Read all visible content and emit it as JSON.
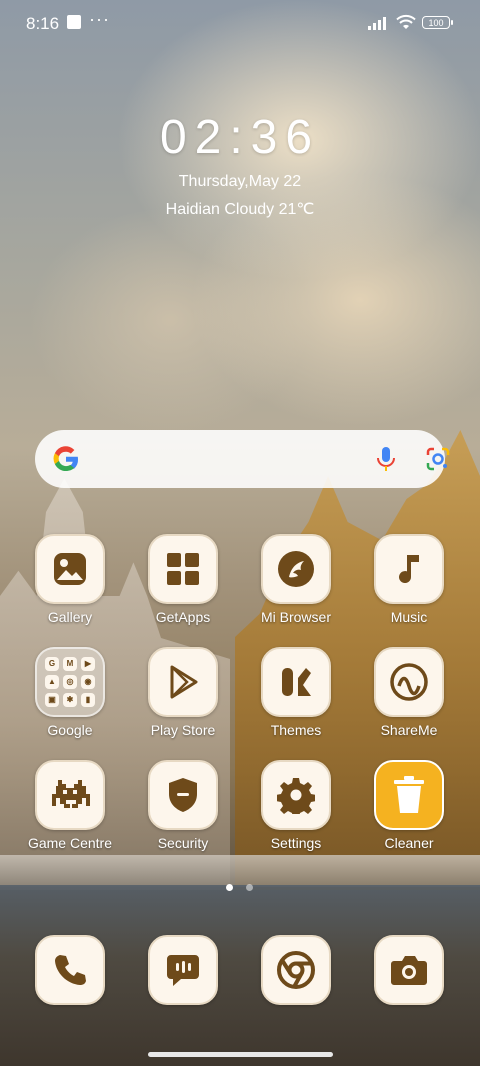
{
  "status_bar": {
    "time": "8:16",
    "more": "···",
    "battery": "100"
  },
  "clock_widget": {
    "time": "02:36",
    "date": "Thursday,May 22",
    "weather": "Haidian Cloudy 21℃"
  },
  "search_bar": {
    "google_icon": "google-g-icon",
    "mic_icon": "mic-icon",
    "lens_icon": "lens-icon"
  },
  "apps": {
    "gallery": "Gallery",
    "getapps": "GetApps",
    "mibrowser": "Mi Browser",
    "music": "Music",
    "google": "Google",
    "playstore": "Play Store",
    "themes": "Themes",
    "shareme": "ShareMe",
    "gamecentre": "Game Centre",
    "security": "Security",
    "settings": "Settings",
    "cleaner": "Cleaner"
  },
  "google_folder": [
    "G",
    "M",
    "▶",
    "▲",
    "◎",
    "◉",
    "▣",
    "✱",
    "▮"
  ],
  "dock": [
    "phone-icon",
    "messages-icon",
    "chrome-icon",
    "camera-icon"
  ],
  "pager": {
    "pages": 2,
    "active": 1
  },
  "colors": {
    "icon_brown": "#6e4a1a",
    "tile_bg": "#fdf6ec",
    "cleaner_accent": "#f5b220"
  }
}
